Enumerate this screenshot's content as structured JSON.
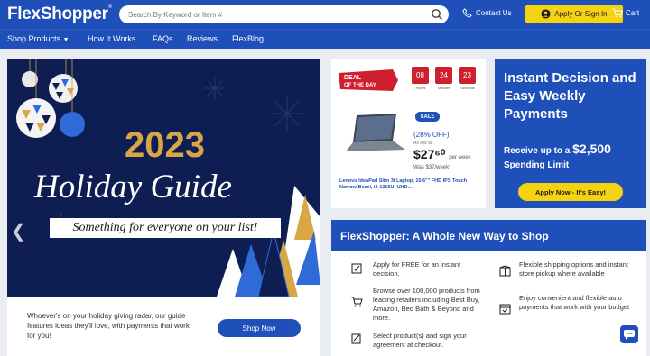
{
  "header": {
    "logo": "FlexShopper",
    "logo_mark": "®",
    "search_placeholder": "Search By Keyword or Item #",
    "contact_label": "Contact Us",
    "signin_label": "Apply Or Sign In",
    "cart_label": "Cart"
  },
  "nav": {
    "items": [
      "Shop Products",
      "How It Works",
      "FAQs",
      "Reviews",
      "FlexBlog"
    ]
  },
  "hero": {
    "year": "2023",
    "title": "Holiday Guide",
    "subtitle": "Something for everyone on your list!",
    "body": "Whoever's on your holiday giving radar, our guide features ideas they'll love, with payments that work for you!",
    "cta": "Shop Now"
  },
  "deal": {
    "badge_line1": "DEAL",
    "badge_line2": "OF THE DAY",
    "timer": [
      {
        "value": "08",
        "label": "Hours"
      },
      {
        "value": "24",
        "label": "Minutes"
      },
      {
        "value": "23",
        "label": "Seconds"
      }
    ],
    "sale": "SALE",
    "discount": "(28% OFF)",
    "as_low_as": "As low as",
    "price": "$27⁶⁰",
    "per_week": "per week",
    "was": "Was $37/week*",
    "product": "Lenovo IdeaPad Slim 3i Laptop, 15.6\"\" FHD IPS Touch Narrow Bezel, i3-1315U, UHD..."
  },
  "instant": {
    "title": "Instant Decision and Easy Weekly Payments",
    "receive_prefix": "Receive up to a ",
    "amount": "$2,500",
    "receive_suffix": "Spending Limit",
    "cta": "Apply Now - It's Easy!"
  },
  "whole": {
    "title": "FlexShopper: A Whole New Way to Shop",
    "features_left": [
      "Apply for FREE for an instant decision.",
      "Browse over 100,000 products from leading retailers including Best Buy, Amazon, Bed Bath & Beyond and more.",
      "Select product(s) and sign your agreement at checkout."
    ],
    "features_right": [
      "Flexible shipping options and instant store pickup where available",
      "Enjoy convenient and flexible auto payments that work with your budget"
    ]
  },
  "colors": {
    "brand_blue": "#1f4fb8",
    "yellow": "#f5d311",
    "hero_navy": "#0e1e52",
    "deal_red": "#cf1f2f",
    "gold": "#d9a645"
  }
}
